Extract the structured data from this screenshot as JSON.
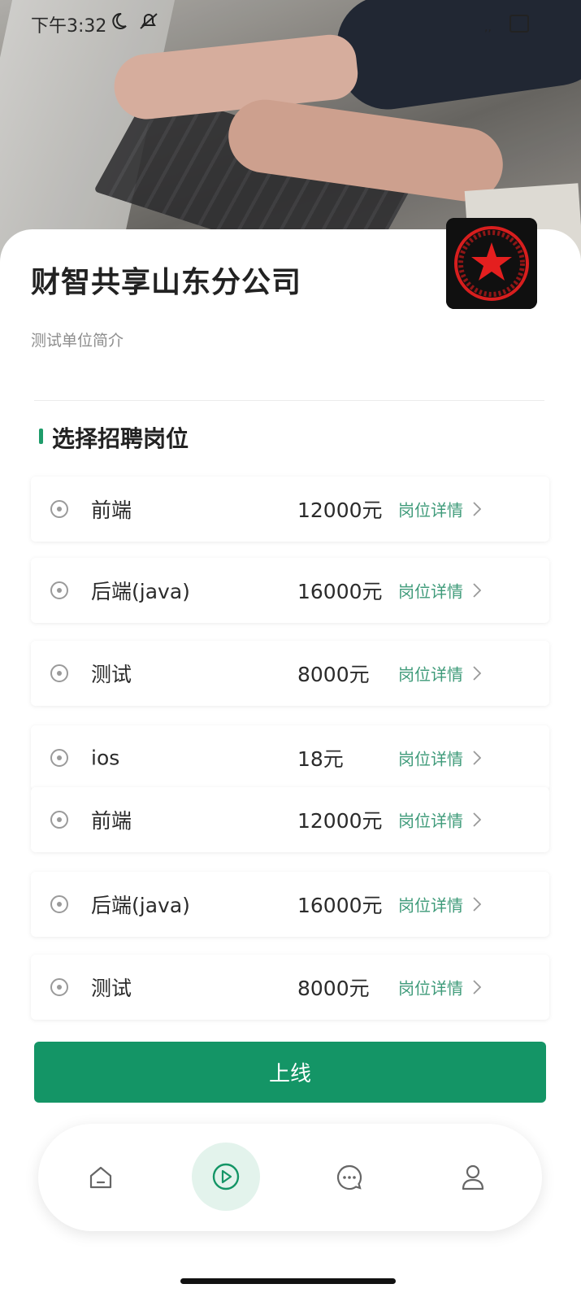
{
  "status_bar": {
    "time": "下午3:32"
  },
  "company": {
    "name": "财智共享山东分公司",
    "intro": "测试单位简介",
    "logo_icon": "red-star-seal-icon"
  },
  "section": {
    "title": "选择招聘岗位"
  },
  "jobs": [
    {
      "name": "前端",
      "salary": "12000元",
      "detail_label": "岗位详情"
    },
    {
      "name": "后端(java)",
      "salary": "16000元",
      "detail_label": "岗位详情"
    },
    {
      "name": "测试",
      "salary": "8000元",
      "detail_label": "岗位详情"
    },
    {
      "name": "ios",
      "salary": "18元",
      "detail_label": "岗位详情"
    },
    {
      "name": "前端",
      "salary": "12000元",
      "detail_label": "岗位详情"
    },
    {
      "name": "后端(java)",
      "salary": "16000元",
      "detail_label": "岗位详情"
    },
    {
      "name": "测试",
      "salary": "8000元",
      "detail_label": "岗位详情"
    }
  ],
  "actions": {
    "online_label": "上线"
  },
  "bottom_nav": {
    "items": [
      {
        "icon": "home-icon"
      },
      {
        "icon": "play-icon",
        "active": true
      },
      {
        "icon": "message-icon"
      },
      {
        "icon": "user-icon"
      }
    ]
  },
  "colors": {
    "primary": "#149566",
    "detail_link": "#3f9b7a",
    "seal_red": "#d81e1e"
  }
}
